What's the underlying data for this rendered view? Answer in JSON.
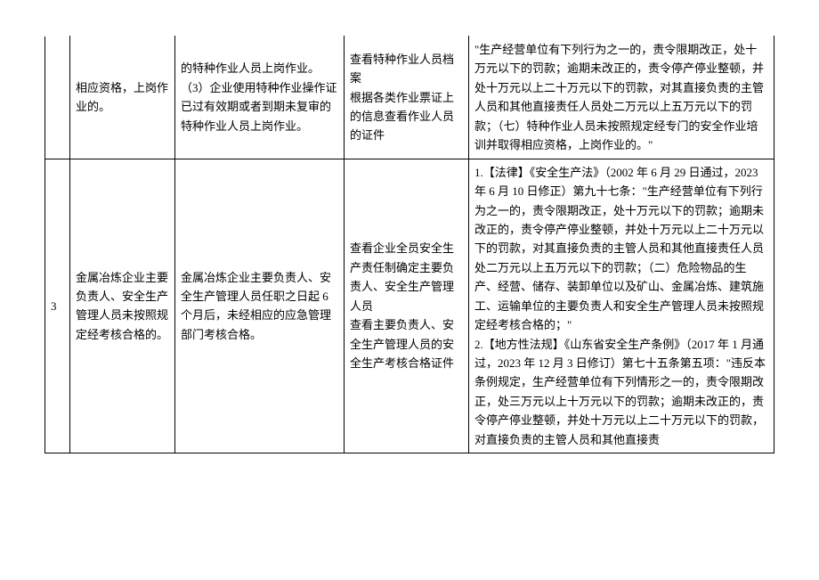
{
  "rows": [
    {
      "num": "",
      "item": "相应资格，上岗作业的。",
      "desc": "的特种作业人员上岗作业。\n（3）企业使用特种作业操作证已过有效期或者到期未复审的特种作业人员上岗作业。",
      "check": "查看特种作业人员档案\n根据各类作业票证上的信息查看作业人员的证件",
      "basis": "\"生产经营单位有下列行为之一的，责令限期改正，处十万元以下的罚款；逾期未改正的，责令停产停业整顿，并处十万元以上二十万元以下的罚款，对其直接负责的主管人员和其他直接责任人员处二万元以上五万元以下的罚款；（七）特种作业人员未按照规定经专门的安全作业培训并取得相应资格，上岗作业的。\""
    },
    {
      "num": "3",
      "item": "金属冶炼企业主要负责人、安全生产管理人员未按照规定经考核合格的。",
      "desc": "金属冶炼企业主要负责人、安全生产管理人员任职之日起 6 个月后，未经相应的应急管理部门考核合格。",
      "check": "查看企业全员安全生产责任制确定主要负责人、安全生产管理人员\n查看主要负责人、安全生产管理人员的安全生产考核合格证件",
      "basis": "1.【法律】《安全生产法》（2002 年 6 月 29 日通过，2023 年 6 月 10 日修正）第九十七条：\"生产经营单位有下列行为之一的，责令限期改正，处十万元以下的罚款；逾期未改正的，责令停产停业整顿，并处十万元以上二十万元以下的罚款，对其直接负责的主管人员和其他直接责任人员处二万元以上五万元以下的罚款；（二）危险物品的生产、经营、储存、装卸单位以及矿山、金属冶炼、建筑施工、运输单位的主要负责人和安全生产管理人员未按照规定经考核合格的；\"\n2.【地方性法规】《山东省安全生产条例》（2017 年 1 月通过，2023 年 12 月 3 日修订）第七十五条第五项：\"违反本条例规定，生产经营单位有下列情形之一的，责令限期改正，处三万元以上十万元以下的罚款；逾期未改正的，责令停产停业整顿，并处十万元以上二十万元以下的罚款，对直接负责的主管人员和其他直接责"
    }
  ]
}
